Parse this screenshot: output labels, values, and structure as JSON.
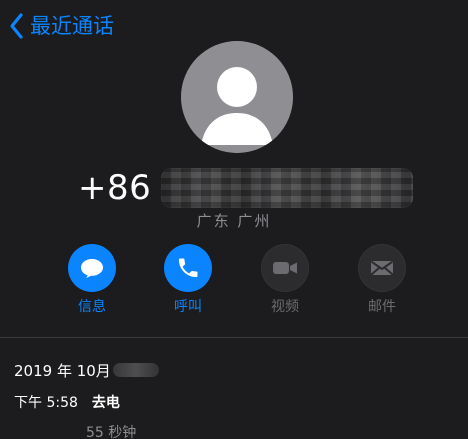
{
  "nav": {
    "back_label": "最近通话"
  },
  "contact": {
    "number_prefix": "+86",
    "location": "广东 广州"
  },
  "actions": [
    {
      "key": "message",
      "label": "信息",
      "enabled": true,
      "icon": "message-bubble-icon"
    },
    {
      "key": "call",
      "label": "呼叫",
      "enabled": true,
      "icon": "phone-icon"
    },
    {
      "key": "video",
      "label": "视频",
      "enabled": false,
      "icon": "video-camera-icon"
    },
    {
      "key": "mail",
      "label": "邮件",
      "enabled": false,
      "icon": "mail-icon"
    }
  ],
  "history": {
    "date_prefix": "2019 年 10月",
    "entries": [
      {
        "time": "下午 5:58",
        "type": "去电",
        "duration": "55 秒钟"
      }
    ]
  },
  "colors": {
    "accent": "#0a84ff",
    "background": "#1c1c1e",
    "secondary_text": "#8e8e93"
  }
}
